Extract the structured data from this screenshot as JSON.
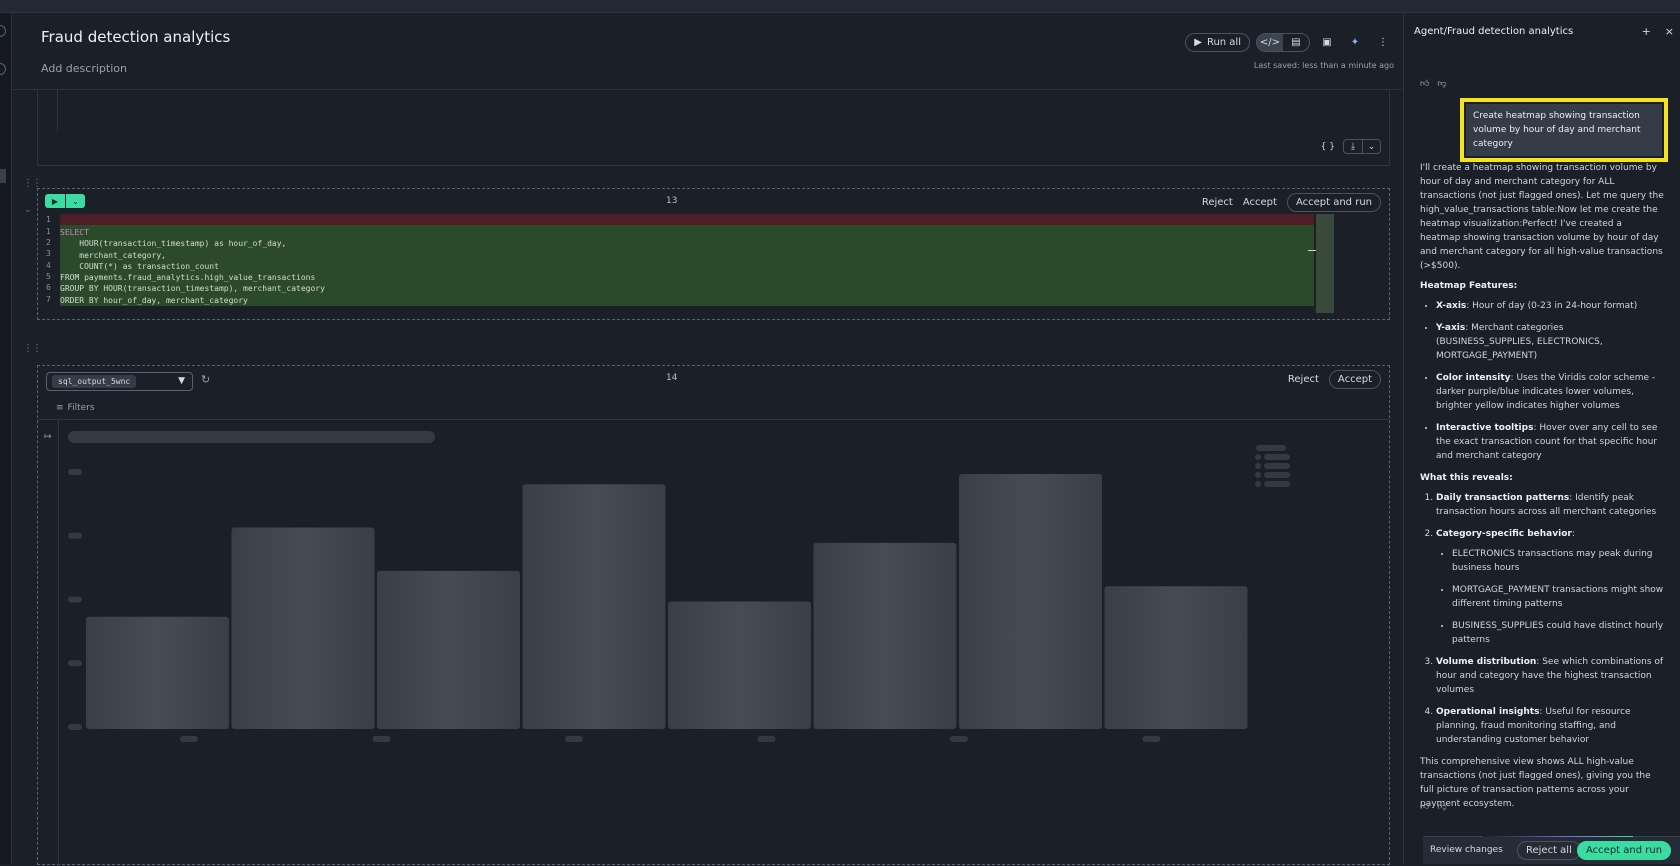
{
  "notebook": {
    "title": "Fraud detection analytics",
    "description": "Add description",
    "last_saved": "Last saved: less than a minute ago",
    "run_all_label": "Run all"
  },
  "prev_cell": {
    "braces": "{ }"
  },
  "code_cell": {
    "number": "13",
    "reject_label": "Reject",
    "accept_label": "Accept",
    "accept_run_label": "Accept and run",
    "deleted_line_number": "1",
    "lines": [
      "SELECT",
      "    HOUR(transaction_timestamp) as hour_of_day,",
      "    merchant_category,",
      "    COUNT(*) as transaction_count",
      "FROM payments.fraud_analytics.high_value_transactions",
      "GROUP BY HOUR(transaction_timestamp), merchant_category",
      "ORDER BY hour_of_day, merchant_category"
    ]
  },
  "output_cell": {
    "number": "14",
    "source": "sql_output_5wnc",
    "reject_label": "Reject",
    "accept_label": "Accept",
    "filters_label": "Filters",
    "placeholder_bars": [
      0.44,
      0.79,
      0.62,
      0.96,
      0.5,
      0.73,
      1.0,
      0.56
    ]
  },
  "agent": {
    "title": "Agent/Fraud detection analytics",
    "user_message": "Create heatmap showing transaction volume by hour of day and merchant category",
    "intro": "I'll create a heatmap showing transaction volume by hour of day and merchant category for ALL transactions (not just flagged ones). Let me query the high_value_transactions table:Now let me create the heatmap visualization:Perfect! I've created a heatmap showing transaction volume by hour of day and merchant category for all high-value transactions (>$500).",
    "features_heading": "Heatmap Features:",
    "features": [
      {
        "term": "X-axis",
        "text": ": Hour of day (0-23 in 24-hour format)"
      },
      {
        "term": "Y-axis",
        "text": ": Merchant categories (BUSINESS_SUPPLIES, ELECTRONICS, MORTGAGE_PAYMENT)"
      },
      {
        "term": "Color intensity",
        "text": ": Uses the Viridis color scheme - darker purple/blue indicates lower volumes, brighter yellow indicates higher volumes"
      },
      {
        "term": "Interactive tooltips",
        "text": ": Hover over any cell to see the exact transaction count for that specific hour and merchant category"
      }
    ],
    "reveals_heading": "What this reveals:",
    "reveals": {
      "r1_term": "Daily transaction patterns",
      "r1_text": ": Identify peak transaction hours across all merchant categories",
      "r2_term": "Category-specific behavior",
      "r2_text": ":",
      "r2_sub": [
        "ELECTRONICS transactions may peak during business hours",
        "MORTGAGE_PAYMENT transactions might show different timing patterns",
        "BUSINESS_SUPPLIES could have distinct hourly patterns"
      ],
      "r3_term": "Volume distribution",
      "r3_text": ": See which combinations of hour and category have the highest transaction volumes",
      "r4_term": "Operational insights",
      "r4_text": ": Useful for resource planning, fraud monitoring staffing, and understanding customer behavior"
    },
    "closing": "This comprehensive view shows ALL high-value transactions (not just flagged ones), giving you the full picture of transaction patterns across your payment ecosystem.",
    "review_changes_label": "Review changes",
    "reject_all_label": "Reject all",
    "accept_run_label": "Accept and run"
  },
  "colors": {
    "accent": "#3ddba4",
    "highlight": "#f4e21a",
    "diff_add": "#2b4a2b",
    "diff_del": "#4d1e26"
  }
}
